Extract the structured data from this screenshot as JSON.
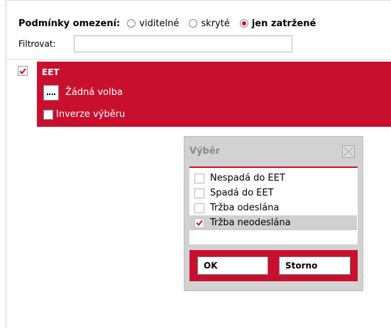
{
  "conditions": {
    "label": "Podmínky omezení:",
    "options": [
      {
        "label": "viditelné",
        "selected": false
      },
      {
        "label": "skryté",
        "selected": false
      },
      {
        "label": "jen zatržené",
        "selected": true
      }
    ]
  },
  "filter": {
    "label": "Filtrovat:",
    "value": ""
  },
  "row": {
    "checked": true,
    "title": "EET",
    "choice_text": "Žádná volba",
    "invert_label": "Inverze výběru",
    "invert_checked": false
  },
  "dialog": {
    "title": "Výběr",
    "items": [
      {
        "label": "Nespadá do EET",
        "checked": false
      },
      {
        "label": "Spadá do EET",
        "checked": false
      },
      {
        "label": "Tržba odeslána",
        "checked": false
      },
      {
        "label": "Tržba neodeslána",
        "checked": true
      }
    ],
    "ok_label": "OK",
    "cancel_label": "Storno"
  },
  "colors": {
    "accent": "#c8102e",
    "panel_gray": "#d2d2d2"
  },
  "icons": {
    "check": "checkmark-icon",
    "close": "close-icon",
    "ellipsis": "ellipsis-icon"
  }
}
